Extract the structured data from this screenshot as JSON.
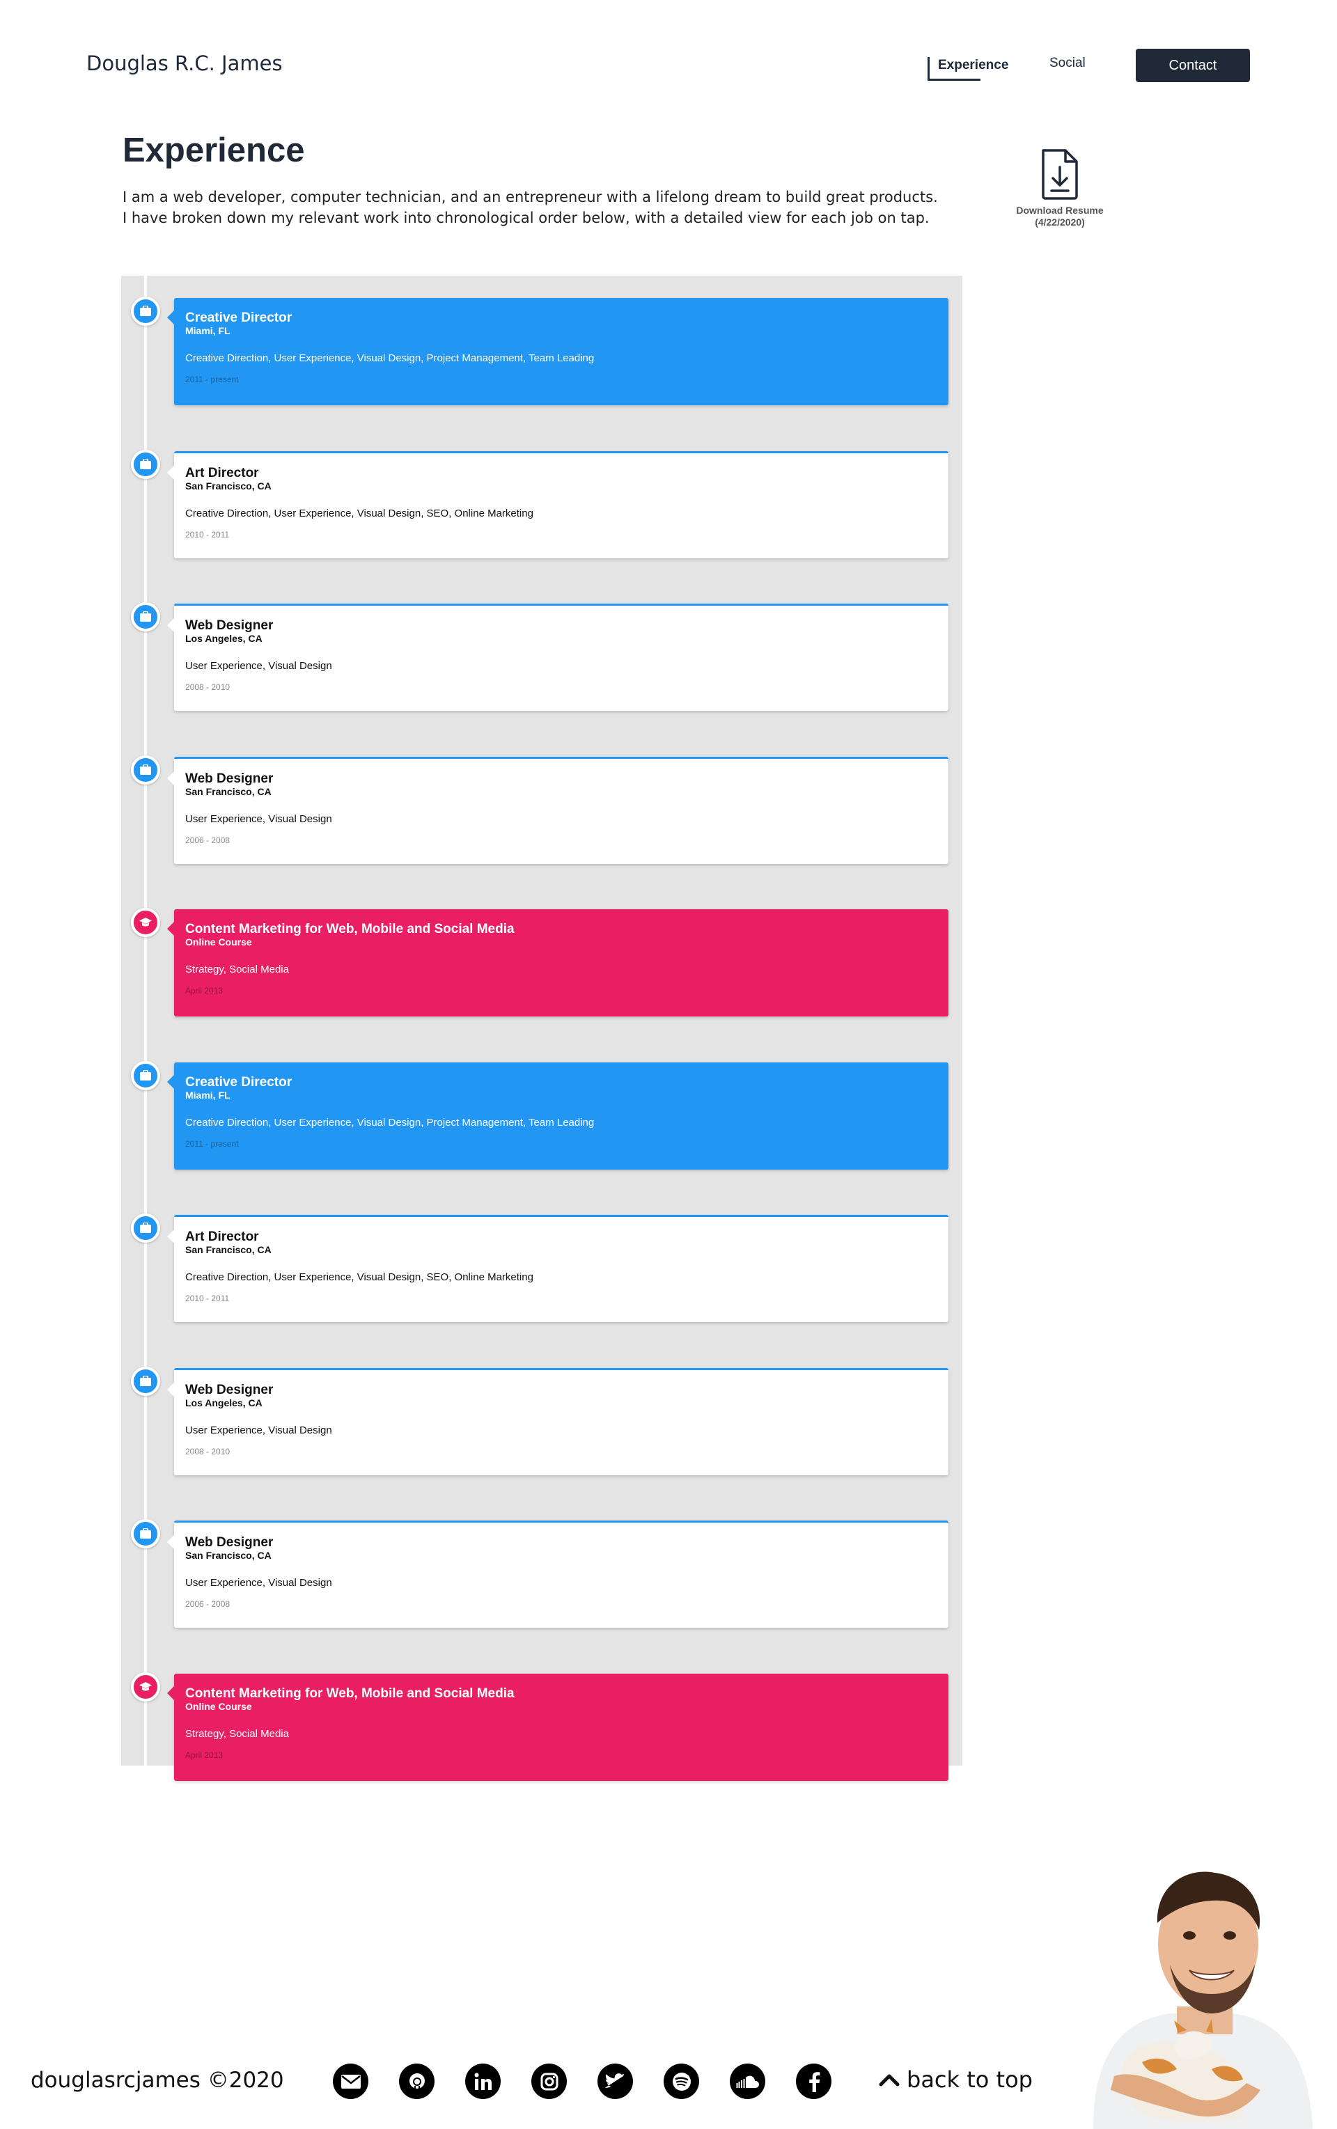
{
  "header": {
    "brand": "Douglas R.C. James",
    "nav": {
      "experience": "Experience",
      "social": "Social",
      "contact": "Contact"
    }
  },
  "main": {
    "title": "Experience",
    "intro_line1": "I am a web developer, computer technician, and an entrepreneur with a lifelong dream to build great products.",
    "intro_line2": "I have broken down my relevant work into chronological order below, with a detailed view for each job on tap.",
    "resume": {
      "label": "Download Resume",
      "date": "(4/22/2020)",
      "icon": "download-file-icon"
    }
  },
  "timeline": {
    "items": [
      {
        "type": "work",
        "style": "blue",
        "title": "Creative Director",
        "location": "Miami, FL",
        "skills": "Creative Direction, User Experience, Visual Design, Project Management, Team Leading",
        "dates": "2011 - present",
        "icon": "briefcase-icon"
      },
      {
        "type": "work",
        "style": "white",
        "title": "Art Director",
        "location": "San Francisco, CA",
        "skills": "Creative Direction, User Experience, Visual Design, SEO, Online Marketing",
        "dates": "2010 - 2011",
        "icon": "briefcase-icon"
      },
      {
        "type": "work",
        "style": "white",
        "title": "Web Designer",
        "location": "Los Angeles, CA",
        "skills": "User Experience, Visual Design",
        "dates": "2008 - 2010",
        "icon": "briefcase-icon"
      },
      {
        "type": "work",
        "style": "white",
        "title": "Web Designer",
        "location": "San Francisco, CA",
        "skills": "User Experience, Visual Design",
        "dates": "2006 - 2008",
        "icon": "briefcase-icon"
      },
      {
        "type": "education",
        "style": "pink",
        "title": "Content Marketing for Web, Mobile and Social Media",
        "location": "Online Course",
        "skills": "Strategy, Social Media",
        "dates": "April 2013",
        "icon": "graduation-cap-icon"
      },
      {
        "type": "work",
        "style": "blue",
        "title": "Creative Director",
        "location": "Miami, FL",
        "skills": "Creative Direction, User Experience, Visual Design, Project Management, Team Leading",
        "dates": "2011 - present",
        "icon": "briefcase-icon"
      },
      {
        "type": "work",
        "style": "white",
        "title": "Art Director",
        "location": "San Francisco, CA",
        "skills": "Creative Direction, User Experience, Visual Design, SEO, Online Marketing",
        "dates": "2010 - 2011",
        "icon": "briefcase-icon"
      },
      {
        "type": "work",
        "style": "white",
        "title": "Web Designer",
        "location": "Los Angeles, CA",
        "skills": "User Experience, Visual Design",
        "dates": "2008 - 2010",
        "icon": "briefcase-icon"
      },
      {
        "type": "work",
        "style": "white",
        "title": "Web Designer",
        "location": "San Francisco, CA",
        "skills": "User Experience, Visual Design",
        "dates": "2006 - 2008",
        "icon": "briefcase-icon"
      },
      {
        "type": "education",
        "style": "pink",
        "title": "Content Marketing for Web, Mobile and Social Media",
        "location": "Online Course",
        "skills": "Strategy, Social Media",
        "dates": "April 2013",
        "icon": "graduation-cap-icon"
      }
    ]
  },
  "footer": {
    "copyright": "douglasrcjames ©2020",
    "socials": [
      "email-icon",
      "github-icon",
      "linkedin-icon",
      "instagram-icon",
      "twitter-icon",
      "spotify-icon",
      "soundcloud-icon",
      "facebook-icon"
    ],
    "back_to_top": "back to top"
  },
  "colors": {
    "work_accent": "#2196f3",
    "education_accent": "#e91e63",
    "dark": "#1f2937",
    "timeline_bg": "#e4e4e4"
  }
}
